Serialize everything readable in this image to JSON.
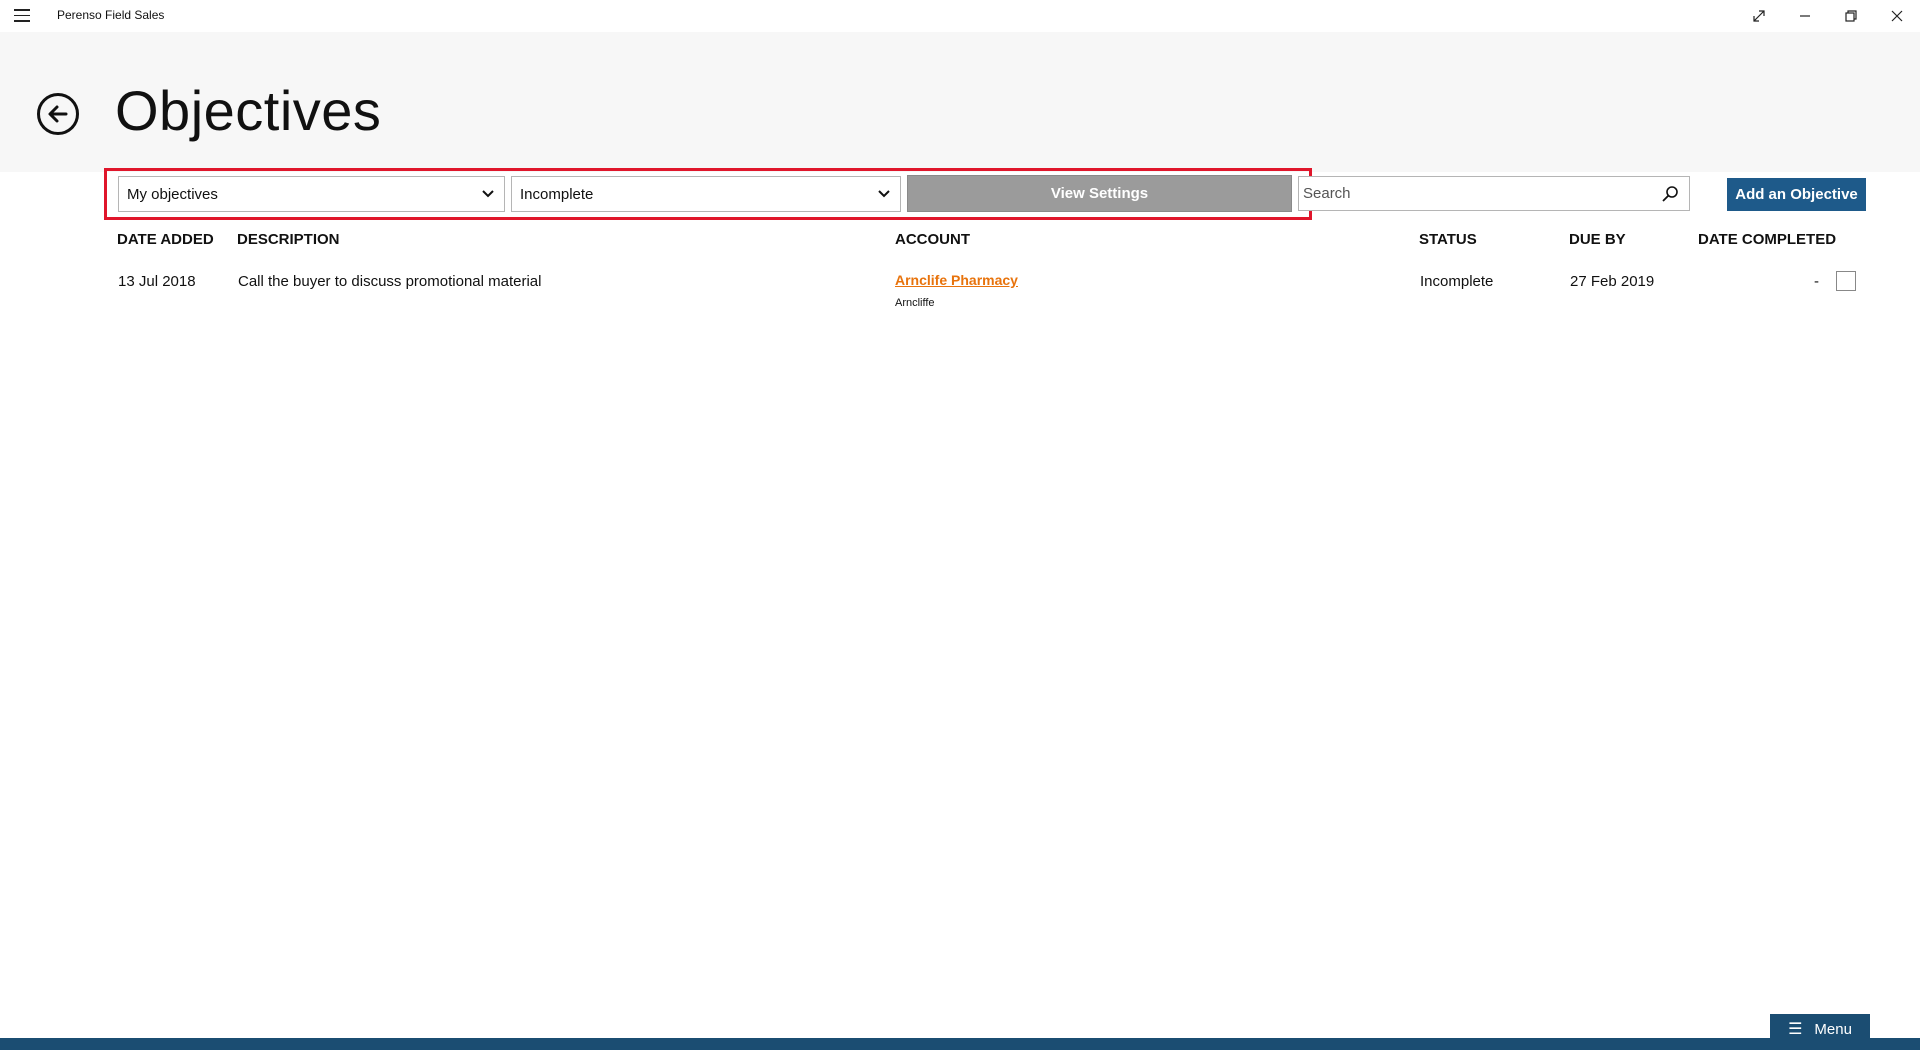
{
  "window": {
    "app_title": "Perenso Field Sales",
    "controls": {
      "fullscreen_icon": "expand-icon",
      "minimize_icon": "minimize-icon",
      "restore_icon": "restore-icon",
      "close_icon": "close-icon"
    }
  },
  "header": {
    "title": "Objectives",
    "back_icon": "back-arrow-icon"
  },
  "toolbar": {
    "owner_filter": {
      "selected": "My objectives"
    },
    "status_filter": {
      "selected": "Incomplete"
    },
    "view_settings_label": "View Settings",
    "search": {
      "placeholder": "Search",
      "value": ""
    },
    "add_label": "Add an Objective"
  },
  "table": {
    "columns": [
      "DATE ADDED",
      "DESCRIPTION",
      "ACCOUNT",
      "STATUS",
      "DUE BY",
      "DATE COMPLETED"
    ],
    "rows": [
      {
        "date_added": "13 Jul 2018",
        "description": "Call the buyer to discuss promotional material",
        "account_name": "Arnclife Pharmacy",
        "account_suburb": "Arncliffe",
        "status": "Incomplete",
        "due_by": "27 Feb 2019",
        "date_completed": "-",
        "checked": false
      }
    ]
  },
  "footer": {
    "menu_label": "Menu",
    "menu_icon": "hamburger-icon"
  },
  "colors": {
    "accent": "#1e5a8a",
    "footer": "#1b4d72",
    "link": "#e8730c",
    "highlight": "#e0162b",
    "view_settings_bg": "#9b9b9b"
  }
}
